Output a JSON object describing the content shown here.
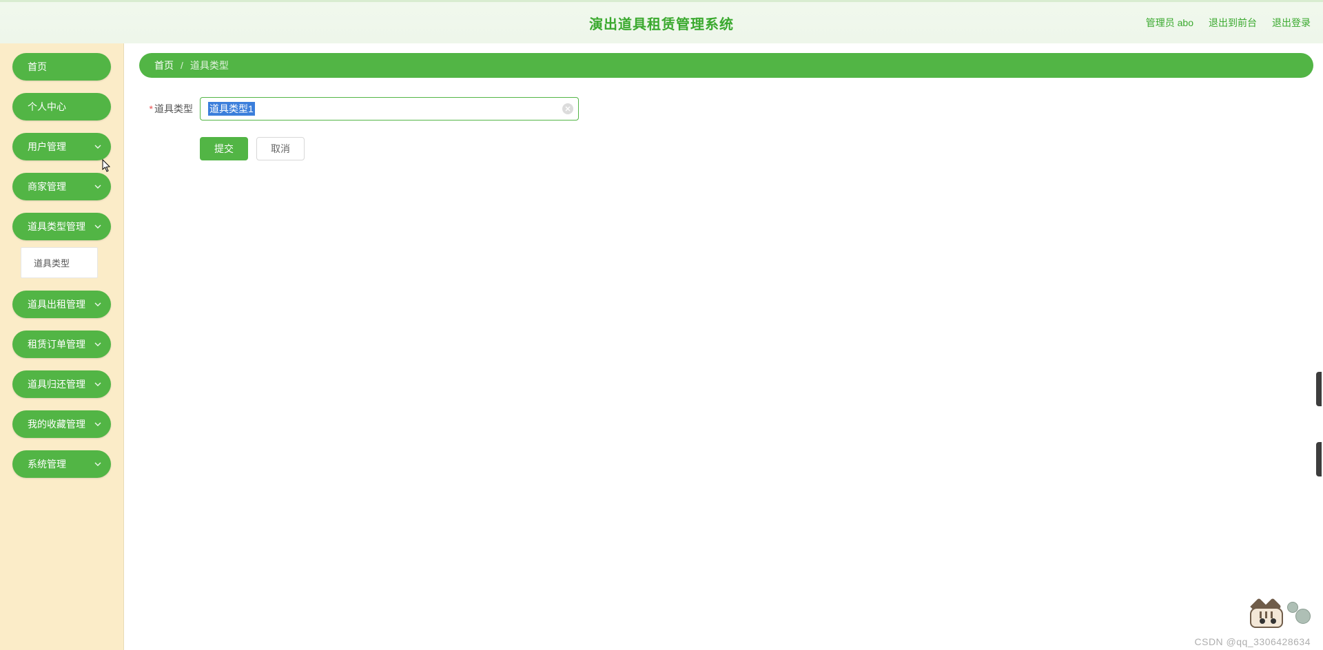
{
  "header": {
    "title": "演出道具租赁管理系统",
    "user": "管理员 abo",
    "to_front": "退出到前台",
    "logout": "退出登录"
  },
  "nav": {
    "home": "首页",
    "profile": "个人中心",
    "users": "用户管理",
    "merchants": "商家管理",
    "prop_types": "道具类型管理",
    "prop_type_sub": "道具类型",
    "rentals": "道具出租管理",
    "orders": "租赁订单管理",
    "returns": "道具归还管理",
    "favorites": "我的收藏管理",
    "system": "系统管理"
  },
  "breadcrumb": {
    "home": "首页",
    "sep": "/",
    "current": "道具类型"
  },
  "form": {
    "label": "道具类型",
    "value": "道具类型1",
    "submit": "提交",
    "cancel": "取消"
  },
  "watermark": "CSDN @qq_3306428634"
}
